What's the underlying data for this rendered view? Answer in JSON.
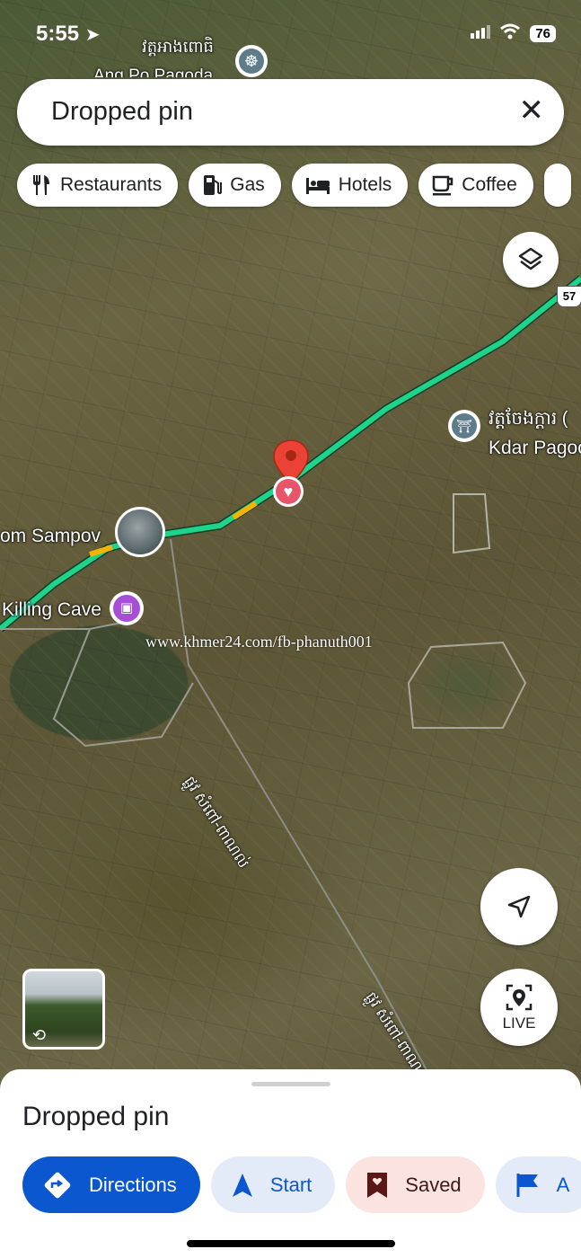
{
  "status_bar": {
    "time": "5:55",
    "battery": "76"
  },
  "search": {
    "text": "Dropped pin"
  },
  "chips": [
    {
      "label": "Restaurants",
      "icon": "fork-knife-icon"
    },
    {
      "label": "Gas",
      "icon": "gas-pump-icon"
    },
    {
      "label": "Hotels",
      "icon": "bed-icon"
    },
    {
      "label": "Coffee",
      "icon": "coffee-cup-icon"
    }
  ],
  "map": {
    "labels": {
      "top_pagoda_kh": "វត្តអាងពោធិ",
      "top_pagoda_en": "Ang Po Pagoda",
      "phnom_sampov": "om Sampov",
      "killing_cave": "Killing Cave",
      "kdar_kh": "វត្តចែងក្ដារ (",
      "kdar_en": "Kdar Pagoc",
      "road_number": "57",
      "road_label_1": "ផ្លូវ សំពៅ-ពាណល់",
      "road_label_2": "ផ្លូវ សំពៅ-ពាណល់"
    },
    "watermark": "www.khmer24.com/fb-phanuth001",
    "live_label": "LIVE"
  },
  "sheet": {
    "title": "Dropped pin",
    "actions": [
      {
        "label": "Directions"
      },
      {
        "label": "Start"
      },
      {
        "label": "Saved"
      },
      {
        "label": "A"
      }
    ]
  },
  "colors": {
    "accent_blue": "#0b57d0",
    "route_green": "#1dd48a",
    "pin_red": "#ea4335",
    "saved_bg": "#fbe3df"
  }
}
